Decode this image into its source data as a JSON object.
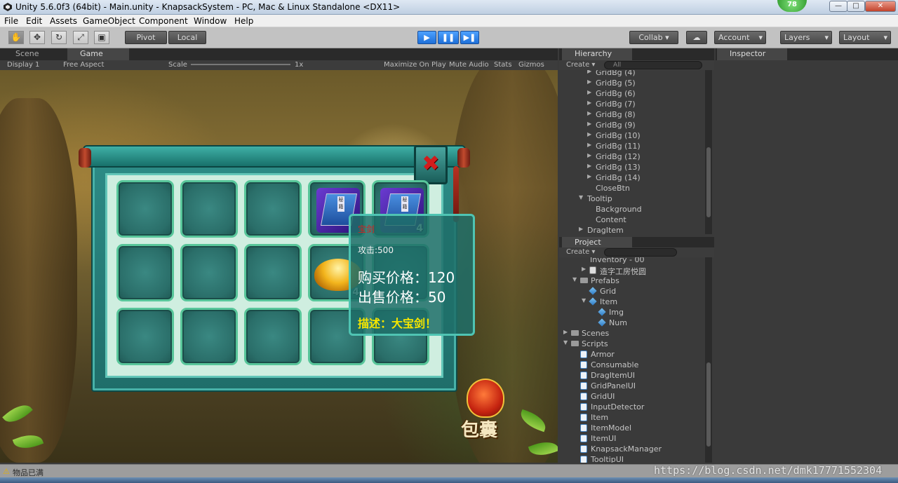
{
  "window": {
    "title": "Unity 5.6.0f3 (64bit) - Main.unity - KnapsackSystem - PC, Mac & Linux Standalone <DX11>",
    "badge": "78",
    "minimize": "—",
    "maximize": "□",
    "close": "✕"
  },
  "menu": [
    "File",
    "Edit",
    "Assets",
    "GameObject",
    "Component",
    "Window",
    "Help"
  ],
  "toolbar": {
    "pivot": "Pivot",
    "local": "Local",
    "collab": "Collab ▾",
    "account": "Account",
    "layers": "Layers",
    "layout": "Layout",
    "dropdown_arrow": "▾",
    "tools": [
      "hand-icon",
      "move-icon",
      "rotate-icon",
      "scale-icon",
      "rect-icon"
    ],
    "tool_glyphs": [
      "✋",
      "✥",
      "↻",
      "⤢",
      "▣"
    ],
    "play_glyph": "▶",
    "pause_glyph": "❚❚",
    "step_glyph": "▶❚",
    "cloud_glyph": "☁"
  },
  "game_panel": {
    "tab_scene": "Scene",
    "tab_game": "Game",
    "display": "Display 1",
    "aspect": "Free Aspect",
    "scale_label": "Scale",
    "scale_value": "1x",
    "maximize": "Maximize On Play",
    "mute": "Mute Audio",
    "stats": "Stats",
    "gizmos": "Gizmos"
  },
  "inventory": {
    "slots": [
      {
        "item": "",
        "count": ""
      },
      {
        "item": "",
        "count": ""
      },
      {
        "item": "",
        "count": ""
      },
      {
        "item": "book",
        "count": ""
      },
      {
        "item": "book",
        "count": "4"
      },
      {
        "item": "",
        "count": ""
      },
      {
        "item": "",
        "count": ""
      },
      {
        "item": "",
        "count": ""
      },
      {
        "item": "gold",
        "count": "4"
      },
      {
        "item": "",
        "count": ""
      },
      {
        "item": "",
        "count": ""
      },
      {
        "item": "",
        "count": ""
      },
      {
        "item": "",
        "count": ""
      },
      {
        "item": "",
        "count": ""
      },
      {
        "item": "",
        "count": ""
      }
    ],
    "book_label": "秘籍",
    "close_glyph": "✖",
    "bag_label": "包囊",
    "tooltip": {
      "name": "宝剑",
      "attack": "攻击:500",
      "buy": "购买价格：120",
      "sell": "出售价格：50",
      "desc": "描述：大宝剑！",
      "name_color": "#d62020",
      "desc_color": "#f5e600"
    }
  },
  "hierarchy": {
    "tab": "Hierarchy",
    "create": "Create ▾",
    "search": "All",
    "items": [
      {
        "label": "GridBg (4)",
        "indent": 3,
        "arrow": "▶"
      },
      {
        "label": "GridBg (5)",
        "indent": 3,
        "arrow": "▶"
      },
      {
        "label": "GridBg (6)",
        "indent": 3,
        "arrow": "▶"
      },
      {
        "label": "GridBg (7)",
        "indent": 3,
        "arrow": "▶"
      },
      {
        "label": "GridBg (8)",
        "indent": 3,
        "arrow": "▶"
      },
      {
        "label": "GridBg (9)",
        "indent": 3,
        "arrow": "▶"
      },
      {
        "label": "GridBg (10)",
        "indent": 3,
        "arrow": "▶"
      },
      {
        "label": "GridBg (11)",
        "indent": 3,
        "arrow": "▶"
      },
      {
        "label": "GridBg (12)",
        "indent": 3,
        "arrow": "▶"
      },
      {
        "label": "GridBg (13)",
        "indent": 3,
        "arrow": "▶"
      },
      {
        "label": "GridBg (14)",
        "indent": 3,
        "arrow": "▶"
      },
      {
        "label": "CloseBtn",
        "indent": 3,
        "arrow": ""
      },
      {
        "label": "Tooltip",
        "indent": 2,
        "arrow": "▼"
      },
      {
        "label": "Background",
        "indent": 3,
        "arrow": ""
      },
      {
        "label": "Content",
        "indent": 3,
        "arrow": ""
      },
      {
        "label": "DragItem",
        "indent": 2,
        "arrow": "▶"
      }
    ]
  },
  "inspector": {
    "tab": "Inspector"
  },
  "project": {
    "tab": "Project",
    "create": "Create ▾",
    "items": [
      {
        "label": "Inventory - 00",
        "indent": 2,
        "arrow": "",
        "icon": "none"
      },
      {
        "label": "造字工房悦圆",
        "indent": 2,
        "arrow": "▶",
        "icon": "font"
      },
      {
        "label": "Prefabs",
        "indent": 1,
        "arrow": "▼",
        "icon": "folder"
      },
      {
        "label": "Grid",
        "indent": 2,
        "arrow": "",
        "icon": "cube"
      },
      {
        "label": "Item",
        "indent": 2,
        "arrow": "▼",
        "icon": "cube"
      },
      {
        "label": "Img",
        "indent": 3,
        "arrow": "",
        "icon": "cube"
      },
      {
        "label": "Num",
        "indent": 3,
        "arrow": "",
        "icon": "cube"
      },
      {
        "label": "Scenes",
        "indent": 0,
        "arrow": "▶",
        "icon": "folder"
      },
      {
        "label": "Scripts",
        "indent": 0,
        "arrow": "▼",
        "icon": "folder"
      },
      {
        "label": "Armor",
        "indent": 1,
        "arrow": "",
        "icon": "script"
      },
      {
        "label": "Consumable",
        "indent": 1,
        "arrow": "",
        "icon": "script"
      },
      {
        "label": "DragItemUI",
        "indent": 1,
        "arrow": "",
        "icon": "script"
      },
      {
        "label": "GridPanelUI",
        "indent": 1,
        "arrow": "",
        "icon": "script"
      },
      {
        "label": "GridUI",
        "indent": 1,
        "arrow": "",
        "icon": "script"
      },
      {
        "label": "InputDetector",
        "indent": 1,
        "arrow": "",
        "icon": "script"
      },
      {
        "label": "Item",
        "indent": 1,
        "arrow": "",
        "icon": "script"
      },
      {
        "label": "ItemModel",
        "indent": 1,
        "arrow": "",
        "icon": "script"
      },
      {
        "label": "ItemUI",
        "indent": 1,
        "arrow": "",
        "icon": "script"
      },
      {
        "label": "KnapsackManager",
        "indent": 1,
        "arrow": "",
        "icon": "script"
      },
      {
        "label": "TooltipUI",
        "indent": 1,
        "arrow": "",
        "icon": "script"
      }
    ]
  },
  "status": {
    "warn_glyph": "⚠",
    "message": "物品已满"
  },
  "watermark": "https://blog.csdn.net/dmk17771552304"
}
